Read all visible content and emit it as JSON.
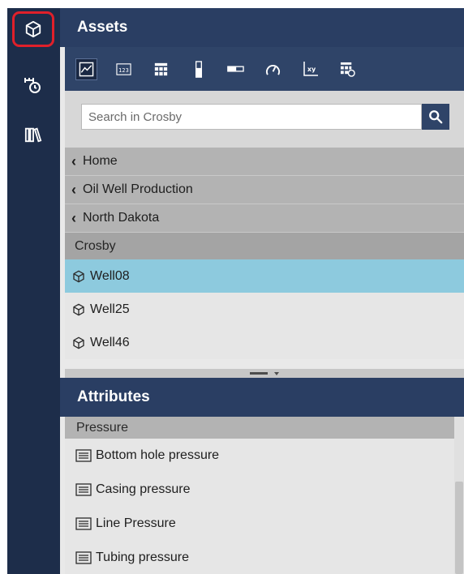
{
  "rail": {
    "items": [
      {
        "icon": "cube-icon",
        "selected": true
      },
      {
        "icon": "scale-clock-icon"
      },
      {
        "icon": "library-icon"
      }
    ],
    "selected_border_color": "#e0202a"
  },
  "assets_panel": {
    "title": "Assets",
    "toolbar": [
      {
        "icon": "trend-chart-icon",
        "active": true
      },
      {
        "icon": "numeric-value-icon",
        "text": "123"
      },
      {
        "icon": "table-icon"
      },
      {
        "icon": "vertical-gauge-icon"
      },
      {
        "icon": "horizontal-bar-gauge-icon"
      },
      {
        "icon": "radial-gauge-icon"
      },
      {
        "icon": "xy-plot-icon"
      },
      {
        "icon": "asset-comparison-table-icon"
      }
    ],
    "search": {
      "placeholder": "Search in Crosby"
    },
    "breadcrumbs": [
      "Home",
      "Oil Well Production",
      "North Dakota"
    ],
    "current_node": "Crosby",
    "assets": [
      {
        "name": "Well08",
        "selected": true
      },
      {
        "name": "Well25"
      },
      {
        "name": "Well46"
      }
    ]
  },
  "attributes_panel": {
    "title": "Attributes",
    "category": "Pressure",
    "items": [
      "Bottom hole pressure",
      "Casing pressure",
      "Line Pressure",
      "Tubing pressure"
    ]
  },
  "colors": {
    "rail": "#1d2d4a",
    "header": "#2a3e63",
    "toolbar": "#2f4468",
    "selected_row": "#8dcade"
  }
}
